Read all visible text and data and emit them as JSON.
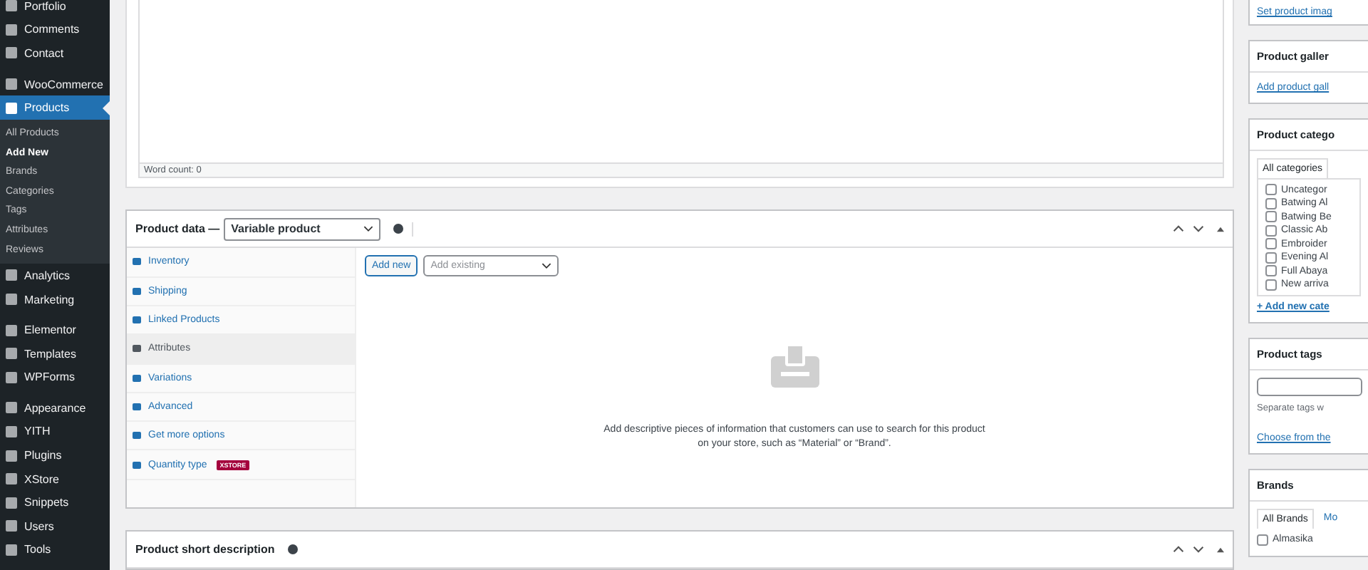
{
  "sidebar": {
    "groups": [
      {
        "items": [
          {
            "label": "Portfolio",
            "selected": false
          },
          {
            "label": "Comments",
            "selected": false
          },
          {
            "label": "Contact",
            "selected": false
          }
        ]
      },
      {
        "items": [
          {
            "label": "WooCommerce",
            "selected": false
          },
          {
            "label": "Products",
            "selected": true,
            "children": [
              {
                "label": "All Products",
                "selected": false
              },
              {
                "label": "Add New",
                "selected": true
              },
              {
                "label": "Brands",
                "selected": false
              },
              {
                "label": "Categories",
                "selected": false
              },
              {
                "label": "Tags",
                "selected": false
              },
              {
                "label": "Attributes",
                "selected": false
              },
              {
                "label": "Reviews",
                "selected": false
              }
            ]
          },
          {
            "label": "Analytics",
            "selected": false
          },
          {
            "label": "Marketing",
            "selected": false
          }
        ]
      },
      {
        "items": [
          {
            "label": "Elementor",
            "selected": false
          },
          {
            "label": "Templates",
            "selected": false
          },
          {
            "label": "WPForms",
            "selected": false
          }
        ]
      },
      {
        "items": [
          {
            "label": "Appearance",
            "selected": false
          },
          {
            "label": "YITH",
            "selected": false
          },
          {
            "label": "Plugins",
            "selected": false
          },
          {
            "label": "XStore",
            "selected": false
          },
          {
            "label": "Snippets",
            "selected": false
          },
          {
            "label": "Users",
            "selected": false
          },
          {
            "label": "Tools",
            "selected": false
          }
        ]
      }
    ]
  },
  "editor": {
    "word_count": "Word count: 0"
  },
  "product_data": {
    "title": "Product data —",
    "type": {
      "value": "Variable product"
    },
    "tabs": [
      {
        "label": "Inventory",
        "selected": false
      },
      {
        "label": "Shipping",
        "selected": false
      },
      {
        "label": "Linked Products",
        "selected": false
      },
      {
        "label": "Attributes",
        "selected": true
      },
      {
        "label": "Variations",
        "selected": false
      },
      {
        "label": "Advanced",
        "selected": false
      },
      {
        "label": "Get more options",
        "selected": false
      },
      {
        "label": "Quantity type",
        "selected": false,
        "badge": "XSTORE"
      }
    ],
    "add_new": "Add new",
    "add_existing": {
      "placeholder": "Add existing"
    },
    "empty_text": "Add descriptive pieces of information that customers can use to search for this product on your store, such as “Material” or “Brand”."
  },
  "short_description": {
    "title": "Product short description"
  },
  "right": {
    "image_link": "Set product imag",
    "gallery": {
      "title": "Product galler",
      "link": "Add product gall"
    },
    "categories": {
      "title": "Product catego",
      "tab": "All categories",
      "items": [
        {
          "label": "Uncategor",
          "checked": false
        },
        {
          "label": "Batwing Al",
          "checked": false
        },
        {
          "label": "Batwing Be",
          "checked": false
        },
        {
          "label": "Classic Ab",
          "checked": false
        },
        {
          "label": "Embroider",
          "checked": false
        },
        {
          "label": "Evening Al",
          "checked": false
        },
        {
          "label": "Full Abaya",
          "checked": false
        },
        {
          "label": "New arriva",
          "checked": false
        }
      ],
      "add_link": "+ Add new cate"
    },
    "tags": {
      "title": "Product tags",
      "hint": "Separate tags w",
      "link": "Choose from the"
    },
    "brands": {
      "title": "Brands",
      "tabs": [
        {
          "label": "All Brands",
          "selected": true
        },
        {
          "label": "Mo",
          "selected": false
        }
      ],
      "items": [
        {
          "label": "Almasika",
          "checked": false
        }
      ]
    }
  }
}
